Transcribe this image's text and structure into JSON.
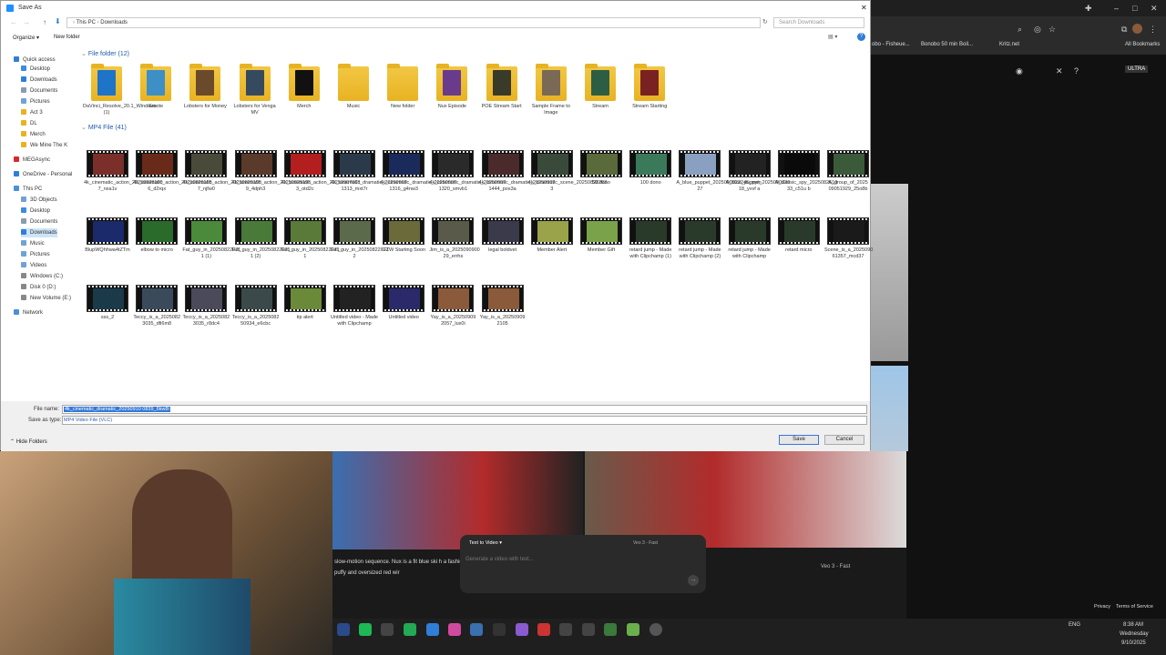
{
  "dialog": {
    "title": "Save As",
    "breadcrumb": [
      "This PC",
      "Downloads"
    ],
    "search_placeholder": "Search Downloads",
    "organize": "Organize",
    "new_folder": "New folder"
  },
  "nav": [
    {
      "label": "Quick access",
      "color": "#2f7ed8"
    },
    {
      "label": "Desktop",
      "color": "#3a8dde"
    },
    {
      "label": "Downloads",
      "color": "#2f7ed8"
    },
    {
      "label": "Documents",
      "color": "#8a9bb0"
    },
    {
      "label": "Pictures",
      "color": "#6fa3d6"
    },
    {
      "label": "Act 3",
      "color": "#e8b322"
    },
    {
      "label": "DL",
      "color": "#e8b322"
    },
    {
      "label": "Merch",
      "color": "#e8b322"
    },
    {
      "label": "We Mine The K",
      "color": "#e8b322"
    },
    {
      "label": "MEGAsync",
      "color": "#d9272e"
    },
    {
      "label": "OneDrive - Personal",
      "color": "#2f7ed8"
    },
    {
      "label": "This PC",
      "color": "#4a90d9"
    },
    {
      "label": "3D Objects",
      "color": "#6fa3d6"
    },
    {
      "label": "Desktop",
      "color": "#3a8dde"
    },
    {
      "label": "Documents",
      "color": "#8a9bb0"
    },
    {
      "label": "Downloads",
      "color": "#2f7ed8"
    },
    {
      "label": "Music",
      "color": "#6fa3d6"
    },
    {
      "label": "Pictures",
      "color": "#6fa3d6"
    },
    {
      "label": "Videos",
      "color": "#6fa3d6"
    },
    {
      "label": "Windows (C:)",
      "color": "#888"
    },
    {
      "label": "Disk 0 (D:)",
      "color": "#888"
    },
    {
      "label": "New Volume (E:)",
      "color": "#888"
    },
    {
      "label": "Network",
      "color": "#4a90d9"
    }
  ],
  "folder_group": "File folder (12)",
  "folders": [
    {
      "label": "DaVinci_Resolve_20.1_Windows (1)",
      "c": "#1d74c9"
    },
    {
      "label": "Emote",
      "c": "#3d8fc6"
    },
    {
      "label": "Lobsters for Money",
      "c": "#6b4a2b"
    },
    {
      "label": "Lobsters for Venga MV",
      "c": "#354a5e"
    },
    {
      "label": "Merch",
      "c": "#111"
    },
    {
      "label": "Music",
      "c": ""
    },
    {
      "label": "New folder",
      "c": ""
    },
    {
      "label": "Nux Episode",
      "c": "#6a3b8c"
    },
    {
      "label": "POE Stream Start",
      "c": "#3a3a28"
    },
    {
      "label": "Sample Frame to Image",
      "c": "#7a6a55"
    },
    {
      "label": "Stream",
      "c": "#2d5e44"
    },
    {
      "label": "Stream Starting",
      "c": "#7a2222"
    }
  ],
  "mp4_group": "MP4 File (41)",
  "videos": [
    {
      "label": "4k_cinematic_action_20250828100 7_nxa1v",
      "c": "#7a2f2a"
    },
    {
      "label": "4k_cinematic_action_20250829195 6_d2rqx",
      "c": "#6a2a1a"
    },
    {
      "label": "4k_cinematic_action_20250829195 7_njfw0",
      "c": "#4a4a3a"
    },
    {
      "label": "4k_cinematic_action_20250829195 9_4dph3",
      "c": "#5a3a2a"
    },
    {
      "label": "4k_cinematic_action_20250907003 3_otd2c",
      "c": "#b31e1e"
    },
    {
      "label": "4k_cinematic_dramatic_20250907 1313_mxt7r",
      "c": "#2a3a4a"
    },
    {
      "label": "4k_cinematic_dramatic_20250907 1316_g4nw3",
      "c": "#1a2a5a"
    },
    {
      "label": "4k_cinematic_dramatic_20250907 1320_smvb1",
      "c": "#2a2a2a"
    },
    {
      "label": "4k_cinematic_dramatic_20250907 1444_pos3a",
      "c": "#4a2a2a"
    },
    {
      "label": "4k_cinematic_scene_20250828203 3",
      "c": "#3a4a3a"
    },
    {
      "label": "50 dono",
      "c": "#5a6a3a"
    },
    {
      "label": "100 dono",
      "c": "#3a7a5a"
    },
    {
      "label": "A_blue_puppet_2025090022245_nym 27",
      "c": "#8aa0c0"
    },
    {
      "label": "A_blue_puppet_2025090920 18_yvvf a",
      "c": "#222"
    },
    {
      "label": "A_classic_spy_2025082510 33_c51u b",
      "c": "#0a0a0a"
    },
    {
      "label": "A_group_of_2025 09051929_25o8b",
      "c": "#3a5a3a"
    },
    {
      "label": "BlupWQhhwa4tZTm",
      "c": "#1a2a6a"
    },
    {
      "label": "elbow to micro",
      "c": "#2a6a2a"
    },
    {
      "label": "Fat_guy_in_20250822071 1 (1)",
      "c": "#4a8a3a"
    },
    {
      "label": "Fat_guy_in_20250822071 1 (2)",
      "c": "#4a7a3a"
    },
    {
      "label": "Fat_guy_in_20250822071 1",
      "c": "#5a7a3a"
    },
    {
      "label": "Fat_guy_in_20250822071 2",
      "c": "#5a6a4a"
    },
    {
      "label": "GZW Starting Soon",
      "c": "#6a6a3a"
    },
    {
      "label": "Jim_is_a_2025090900 29_errhs",
      "c": "#5a5a4a"
    },
    {
      "label": "legal boldvet",
      "c": "#3a3a4a"
    },
    {
      "label": "Member Alert",
      "c": "#9aa24a"
    },
    {
      "label": "Member Gift",
      "c": "#7aa24a"
    },
    {
      "label": "retard jump - Made with Clipchamp (1)",
      "c": "#2a3a2a"
    },
    {
      "label": "retard jump - Made with Clipchamp (2)",
      "c": "#2a3a2a"
    },
    {
      "label": "retard jump - Made with Clipchamp",
      "c": "#2a3a2a"
    },
    {
      "label": "retard micro",
      "c": "#2a3a2a"
    },
    {
      "label": "Scene_is_a_2025090 61357_mcd37",
      "c": "#1a1a1a"
    },
    {
      "label": "sss_2",
      "c": "#1a3a4a"
    },
    {
      "label": "Teccy_is_a_2025082 3035_dfi6m8",
      "c": "#3a4a5a"
    },
    {
      "label": "Teccy_is_a_2025082 3035_r8dc4",
      "c": "#4a4a5a"
    },
    {
      "label": "Teccy_is_a_2025082 50934_e6cbc",
      "c": "#3a4a4a"
    },
    {
      "label": "tip alert",
      "c": "#6a8a3a"
    },
    {
      "label": "Untitled video - Made with Clipchamp",
      "c": "#222"
    },
    {
      "label": "Untitled video",
      "c": "#2a2a6a"
    },
    {
      "label": "Yay_is_a_20250909 2057_lux0i",
      "c": "#8a5a3a"
    },
    {
      "label": "Yay_is_a_20250909 2105",
      "c": "#8a5a3a"
    }
  ],
  "file_name_label": "File name:",
  "file_name": "4k_cinematic_dramatic_20250910 0839_6kw8i",
  "save_type_label": "Save as type:",
  "save_type": "MP4 Video File (VLC)",
  "hide_folders": "Hide Folders",
  "save": "Save",
  "cancel": "Cancel",
  "browser": {
    "bookmarks": [
      "obo - Fisheue...",
      "Bonobo 50 min Boil...",
      "Kritz.net",
      "All Bookmarks"
    ],
    "ultra": "ULTRA"
  },
  "video_panel": {
    "prompt_text": "slow-motion sequence. Nux is a fit blue ski h a fashionable puffy and oversized red wir",
    "mode": "Text to Video",
    "model": "Veo 3 - Fast",
    "placeholder": "Generate a video with text...",
    "model2": "Veo 3 - Fast",
    "privacy": "Privacy",
    "terms": "Terms of Service"
  },
  "tray": {
    "lang": "ENG",
    "time": "8:38 AM",
    "day": "Wednesday",
    "date": "9/10/2025"
  }
}
